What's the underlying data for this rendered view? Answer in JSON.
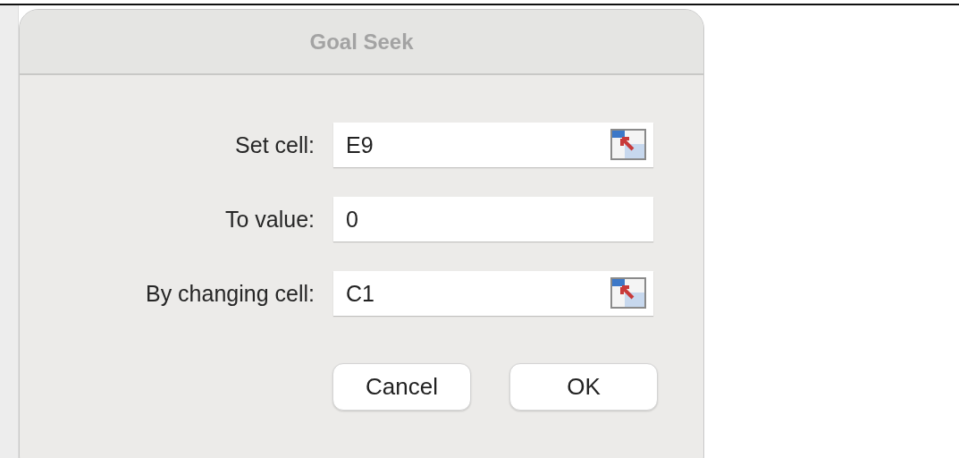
{
  "dialog": {
    "title": "Goal Seek"
  },
  "fields": [
    {
      "label": "Set cell:",
      "value": "E9",
      "kind": "reference"
    },
    {
      "label": "To value:",
      "value": "0",
      "kind": "plain"
    },
    {
      "label": "By changing cell:",
      "value": "C1",
      "kind": "reference"
    }
  ],
  "buttons": [
    "Cancel",
    "OK"
  ]
}
